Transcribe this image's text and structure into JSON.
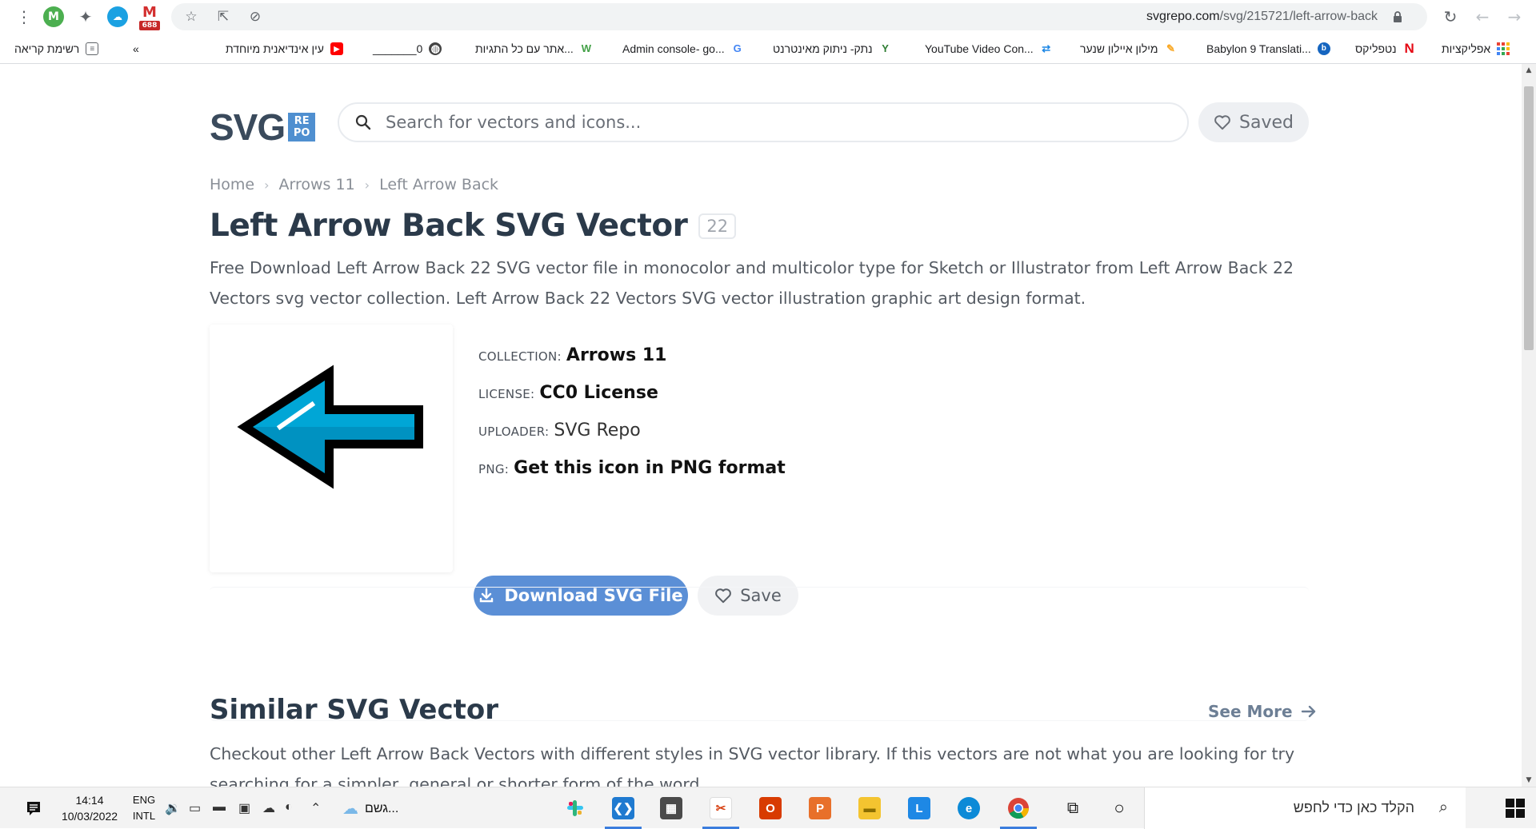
{
  "browser": {
    "profile_letter": "M",
    "mail_badge": "688",
    "url_host": "svgrepo.com",
    "url_path": "/svg/215721/left-arrow-back",
    "bookmarks": [
      {
        "label": "אפליקציות",
        "icon": "apps-grid-icon",
        "color": "#e53935"
      },
      {
        "label": "נטפליקס",
        "icon": "netflix-icon",
        "color": "#e50914"
      },
      {
        "label": "Babylon 9 Translati...",
        "icon": "babylon-icon",
        "color": "#1565c0"
      },
      {
        "label": "מילון איילון שנער",
        "icon": "pen-icon",
        "color": "#f9a825"
      },
      {
        "label": "YouTube Video Con...",
        "icon": "convert-icon",
        "color": "#1e88e5"
      },
      {
        "label": "נתק- ניתוק מאינטרנט",
        "icon": "plug-icon",
        "color": "#2e7d32"
      },
      {
        "label": "Admin console- go...",
        "icon": "google-icon",
        "color": "#4285f4"
      },
      {
        "label": "אתר עם כל התגיות...",
        "icon": "w-icon",
        "color": "#43a047"
      },
      {
        "label": "_______0",
        "icon": "globe-icon",
        "color": "#444444"
      },
      {
        "label": "עין אינדיאנית מיוחדת",
        "icon": "youtube-icon",
        "color": "#ff0000"
      }
    ],
    "reading_list": "רשימת קריאה",
    "overflow": "«"
  },
  "site": {
    "logo_text": "SVG",
    "logo_badge": [
      "RE",
      "PO"
    ],
    "search_placeholder": "Search for vectors and icons...",
    "saved_label": "Saved",
    "breadcrumb": [
      "Home",
      "Arrows 11",
      "Left Arrow Back"
    ],
    "title": "Left Arrow Back SVG Vector",
    "title_count": "22",
    "description": "Free Download Left Arrow Back 22 SVG vector file in monocolor and multicolor type for Sketch or Illustrator from Left Arrow Back 22 Vectors svg vector collection. Left Arrow Back 22 Vectors SVG vector illustration graphic art design format.",
    "meta": {
      "collection_key": "COLLECTION:",
      "collection_val": "Arrows 11",
      "license_key": "LICENSE:",
      "license_val": "CC0 License",
      "uploader_key": "UPLOADER:",
      "uploader_val": "SVG Repo",
      "png_key": "PNG:",
      "png_val": "Get this icon in PNG format"
    },
    "download_label": "Download SVG File",
    "save_label": "Save",
    "similar_title": "Similar SVG Vector",
    "see_more": "See More",
    "similar_desc": "Checkout other Left Arrow Back Vectors with different styles in SVG vector library. If this vectors are not what you are looking for try searching for a simpler, general or shorter form of the word."
  },
  "colors": {
    "accent": "#5b8fd6",
    "arrow_fill": "#00a6d6",
    "arrow_dark": "#0082b0"
  },
  "taskbar": {
    "time": "14:14",
    "date": "10/03/2022",
    "lang_1": "ENG",
    "lang_2": "INTL",
    "weather": "גשם...",
    "search_text": "הקלד כאן כדי לחפש",
    "apps": [
      "slack-icon",
      "vscode-icon",
      "calculator-icon",
      "snip-icon",
      "office-icon",
      "powerpoint-icon",
      "explorer-icon",
      "l-app-icon",
      "edge-icon",
      "chrome-icon",
      "task-view-icon",
      "cortana-icon"
    ]
  }
}
